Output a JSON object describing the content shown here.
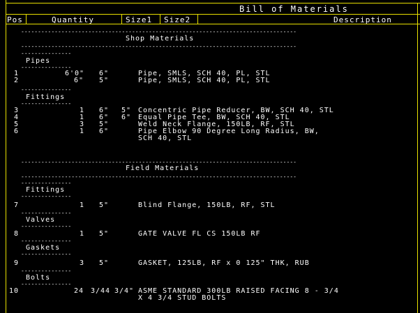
{
  "title": "Bill of Materials",
  "headers": {
    "pos": "Pos",
    "quantity": "Quantity",
    "size1": "Size1",
    "size2": "Size2",
    "description": "Description"
  },
  "sections": {
    "shop": "Shop Materials",
    "field": "Field Materials"
  },
  "categories": {
    "pipes": "Pipes",
    "fittings_shop": "Fittings",
    "fittings_field": "Fittings",
    "valves": "Valves",
    "gaskets": "Gaskets",
    "bolts": "Bolts"
  },
  "rows": [
    {
      "pos": "1",
      "qty": "6'0\"",
      "size1": "6\"",
      "size2": "",
      "desc": "Pipe, SMLS, SCH 40, PL, STL",
      "desc2": ""
    },
    {
      "pos": "2",
      "qty": "6\"",
      "size1": "5\"",
      "size2": "",
      "desc": "Pipe, SMLS, SCH 40, PL, STL",
      "desc2": ""
    },
    {
      "pos": "3",
      "qty": "1",
      "size1": "6\"",
      "size2": "5\"",
      "desc": "Concentric Pipe Reducer, BW, SCH 40, STL",
      "desc2": ""
    },
    {
      "pos": "4",
      "qty": "1",
      "size1": "6\"",
      "size2": "6\"",
      "desc": "Equal Pipe Tee, BW, SCH 40, STL",
      "desc2": ""
    },
    {
      "pos": "5",
      "qty": "3",
      "size1": "5\"",
      "size2": "",
      "desc": "Weld Neck Flange, 150LB, RF, STL",
      "desc2": ""
    },
    {
      "pos": "6",
      "qty": "1",
      "size1": "6\"",
      "size2": "",
      "desc": "Pipe Elbow 90 Degree Long Radius, BW,",
      "desc2": "SCH 40, STL"
    },
    {
      "pos": "7",
      "qty": "1",
      "size1": "5\"",
      "size2": "",
      "desc": "Blind Flange, 150LB, RF, STL",
      "desc2": ""
    },
    {
      "pos": "8",
      "qty": "1",
      "size1": "5\"",
      "size2": "",
      "desc": "GATE VALVE FL CS 150LB RF",
      "desc2": ""
    },
    {
      "pos": "9",
      "qty": "3",
      "size1": "5\"",
      "size2": "",
      "desc": "GASKET, 125LB, RF x 0 125\" THK, RUB",
      "desc2": ""
    },
    {
      "pos": "10",
      "qty": "24",
      "size1": "3/44",
      "size2": "3/4\"",
      "desc": "ASME STANDARD 300LB RAISED FACING 8 - 3/4",
      "desc2": "X 4 3/4 STUD BOLTS"
    }
  ]
}
